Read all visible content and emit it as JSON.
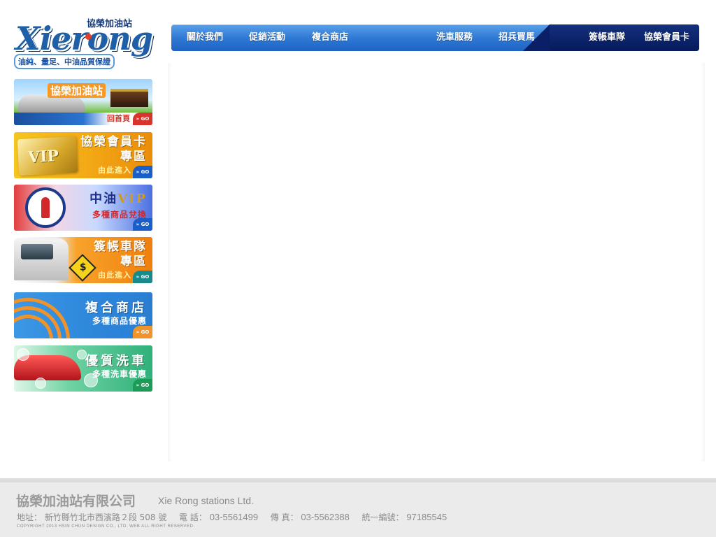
{
  "logo": {
    "brand": "Xierong",
    "brand_cn": "協榮加油站",
    "tagline": "油純、量足、中油品質保證"
  },
  "nav": {
    "items": [
      {
        "label": "關於我們"
      },
      {
        "label": "促銷活動"
      },
      {
        "label": "複合商店"
      },
      {
        "label": "洗車服務"
      },
      {
        "label": "招兵買馬"
      },
      {
        "label": "簽帳車隊"
      },
      {
        "label": "協榮會員卡"
      }
    ],
    "colors": {
      "primary": "#2f7ad6",
      "dark": "#0a1f66"
    }
  },
  "sidebar": {
    "banners": [
      {
        "title": "協榮加油站",
        "sub": "回首頁",
        "go": "» GO"
      },
      {
        "title_line1": "協榮會員卡",
        "title_line2": "專區",
        "sub": "由此進入",
        "card_text": "VIP",
        "go": "» GO"
      },
      {
        "title_cn": "中油",
        "title_vip": "VIP",
        "sub": "多種商品兌換",
        "go": "» GO"
      },
      {
        "title_line1": "簽帳車隊",
        "title_line2": "專區",
        "sub": "由此進入",
        "icon_symbol": "$",
        "go": "» GO"
      },
      {
        "title": "複合商店",
        "sub": "多種商品優惠",
        "go": "» GO"
      },
      {
        "title": "優質洗車",
        "sub": "多種洗車優惠",
        "go": "» GO"
      }
    ]
  },
  "footer": {
    "company": "協榮加油站有限公司",
    "company_en": "Xie Rong stations Ltd.",
    "address_label": "地址：",
    "address": "新竹縣竹北市西濱路２段 508 號",
    "phone_label": "電 話：",
    "phone": "03-5561499",
    "fax_label": "傳 真：",
    "fax": "03-5562388",
    "tax_label": "統一編號：",
    "tax_id": "97185545",
    "copyright": "COPYRIGHT 2013 HSIN CHUN DESIGN CO., LTD. WEB ALL RIGHT RESERVED."
  }
}
